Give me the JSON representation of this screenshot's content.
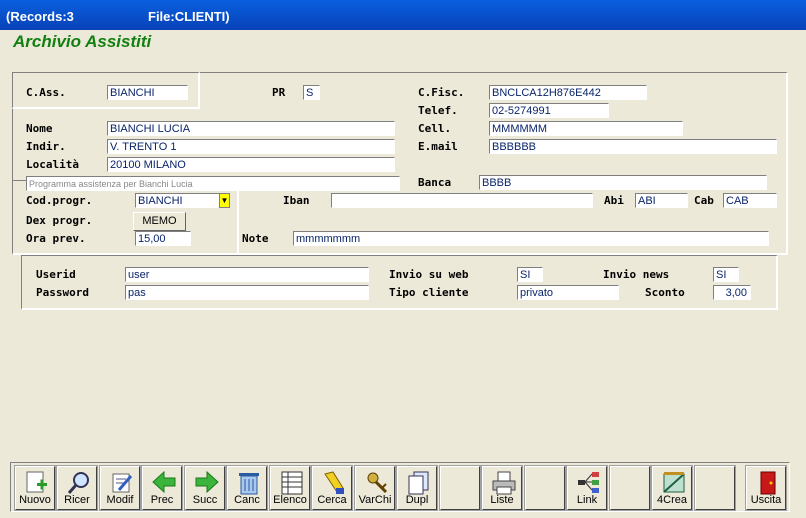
{
  "window": {
    "records": "(Records:3",
    "file": "File:CLIENTI)"
  },
  "app_title": "Archivio Assistiti",
  "form": {
    "cass": {
      "label": "C.Ass.",
      "value": "BIANCHI"
    },
    "pr": {
      "label": "PR",
      "value": "S"
    },
    "cfisc": {
      "label": "C.Fisc.",
      "value": "BNCLCA12H876E442"
    },
    "telef": {
      "label": "Telef.",
      "value": "02-5274991"
    },
    "nome": {
      "label": "Nome",
      "value": "BIANCHI LUCIA"
    },
    "cell": {
      "label": "Cell.",
      "value": "MMMMMM"
    },
    "indir": {
      "label": "Indir.",
      "value": "V. TRENTO 1"
    },
    "email": {
      "label": "E.mail",
      "value": "BBBBBB"
    },
    "localita": {
      "label": "Località",
      "value": "20100  MILANO"
    },
    "programma_hint": "Programma assistenza per Bianchi Lucia",
    "banca": {
      "label": "Banca",
      "value": "BBBB"
    },
    "codprogr": {
      "label": "Cod.progr.",
      "value": "BIANCHI",
      "dropdown_glyph": "▼"
    },
    "iban": {
      "label": "Iban",
      "value": ""
    },
    "abi": {
      "label": "Abi",
      "value": "ABI"
    },
    "cab": {
      "label": "Cab",
      "value": "CAB"
    },
    "dexprogr": {
      "label": "Dex progr.",
      "button": "MEMO"
    },
    "oraprev": {
      "label": "Ora prev.",
      "value": "15,00"
    },
    "note": {
      "label": "Note",
      "value": "mmmmmmm"
    },
    "userid": {
      "label": "Userid",
      "value": "user"
    },
    "password": {
      "label": "Password",
      "value": "pas"
    },
    "invioweb": {
      "label": "Invio su web",
      "value": "SI"
    },
    "invionews": {
      "label": "Invio news",
      "value": "SI"
    },
    "tipocliente": {
      "label": "Tipo cliente",
      "value": "privato"
    },
    "sconto": {
      "label": "Sconto",
      "value": "3,00"
    }
  },
  "toolbar": [
    {
      "label": "Nuovo",
      "icon": "new-document-icon"
    },
    {
      "label": "Ricer",
      "icon": "magnifier-icon"
    },
    {
      "label": "Modif",
      "icon": "edit-document-icon"
    },
    {
      "label": "Prec",
      "icon": "arrow-left-icon"
    },
    {
      "label": "Succ",
      "icon": "arrow-right-icon"
    },
    {
      "label": "Canc",
      "icon": "trash-icon"
    },
    {
      "label": "Elenco",
      "icon": "list-icon"
    },
    {
      "label": "Cerca",
      "icon": "flashlight-icon"
    },
    {
      "label": "VarChi",
      "icon": "keys-icon"
    },
    {
      "label": "Dupl",
      "icon": "duplicate-icon"
    },
    {
      "label": "",
      "icon": ""
    },
    {
      "label": "Liste",
      "icon": "printer-icon"
    },
    {
      "label": "",
      "icon": ""
    },
    {
      "label": "Link",
      "icon": "link-tree-icon"
    },
    {
      "label": "",
      "icon": ""
    },
    {
      "label": "4Crea",
      "icon": "create-icon"
    },
    {
      "label": "",
      "icon": ""
    },
    {
      "label": "Uscita",
      "icon": "exit-door-icon"
    }
  ],
  "colors": {
    "title_bar": "#0a5fe0",
    "app_title": "#108010",
    "field_text": "#0a246a",
    "dropdown": "#ffff00"
  }
}
